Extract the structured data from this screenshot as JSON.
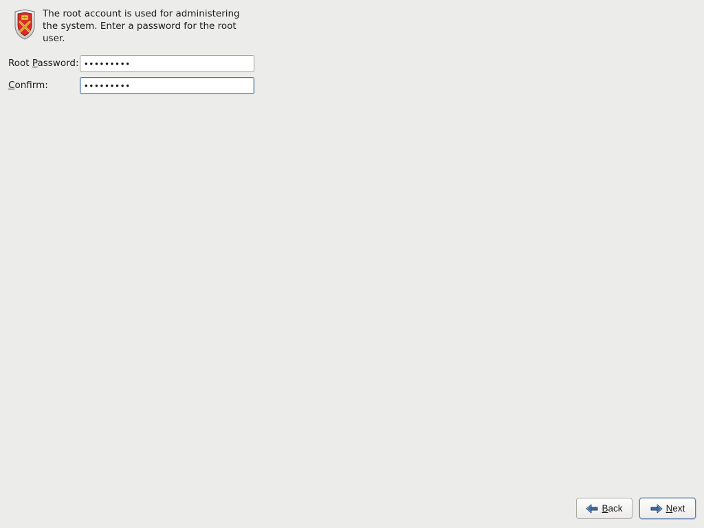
{
  "header": {
    "description": "The root account is used for administering the system.  Enter a password for the root user."
  },
  "form": {
    "root_password_label_pre": "Root ",
    "root_password_label_u": "P",
    "root_password_label_post": "assword:",
    "confirm_label_u": "C",
    "confirm_label_post": "onfirm:",
    "root_password_value": "•••••••••",
    "confirm_value": "•••••••••"
  },
  "buttons": {
    "back_u": "B",
    "back_post": "ack",
    "next_u": "N",
    "next_post": "ext"
  }
}
